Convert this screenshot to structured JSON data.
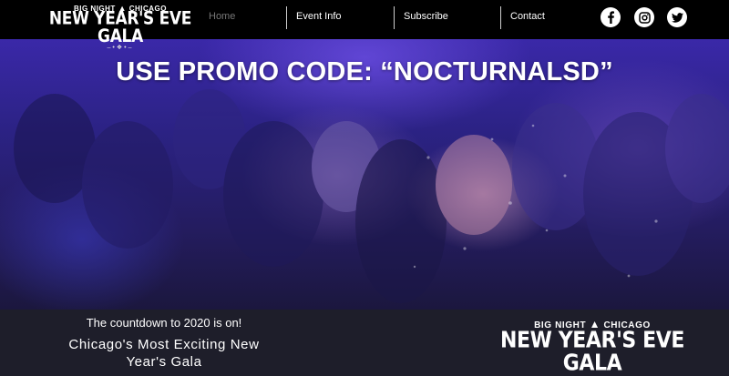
{
  "logo": {
    "line1_left": "BIG NIGHT",
    "line1_right": "CHICAGO",
    "line2": "NEW YEAR'S EVE GALA"
  },
  "nav": {
    "items": [
      {
        "label": "Home",
        "active": true
      },
      {
        "label": "Event Info",
        "active": false
      },
      {
        "label": "Subscribe",
        "active": false
      },
      {
        "label": "Contact",
        "active": false
      }
    ]
  },
  "social": {
    "icons": [
      "facebook-icon",
      "instagram-icon",
      "twitter-icon"
    ]
  },
  "hero": {
    "promo": "USE PROMO CODE: “NOCTURNALSD”"
  },
  "footer": {
    "countdown": "The countdown to 2020 is on!",
    "tagline_line1": "Chicago's Most Exciting New",
    "tagline_line2": "Year's Gala"
  },
  "colors": {
    "nav_bg": "#000000",
    "nav_active": "#777777",
    "footer_bg": "#1e1e2a",
    "hero_tint": "#2b2283"
  }
}
